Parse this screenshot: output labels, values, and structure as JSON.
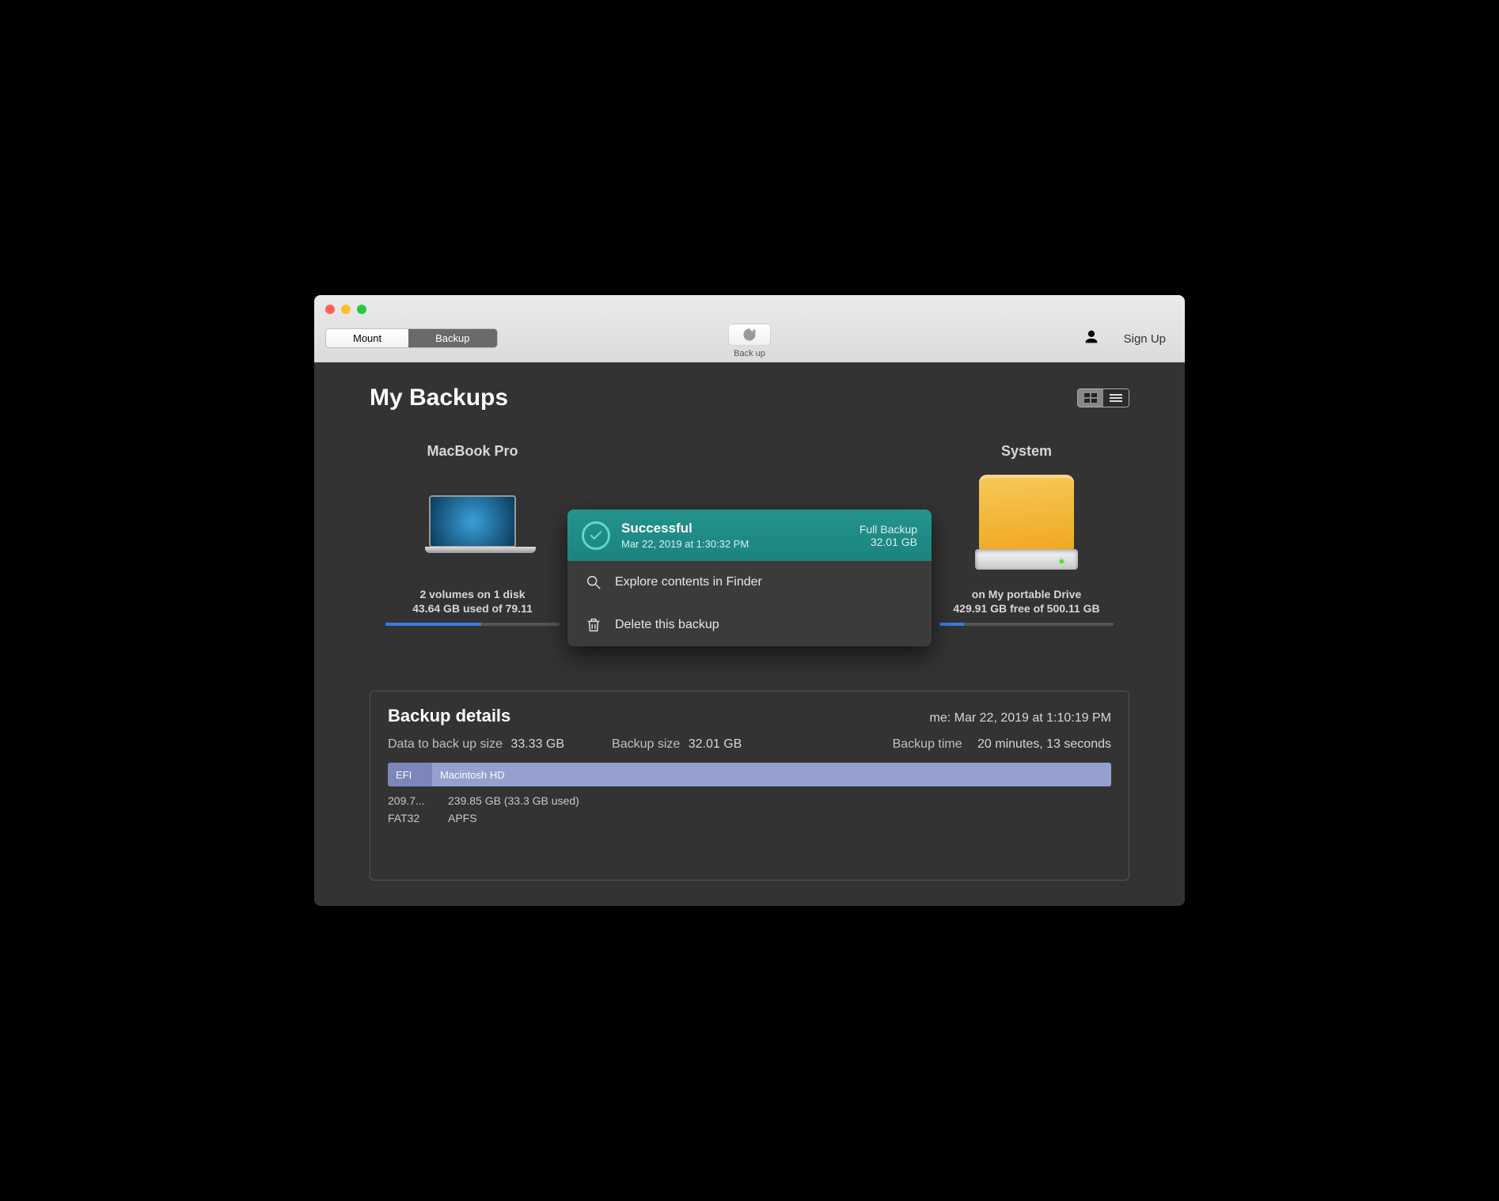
{
  "tabs": {
    "mount": "Mount",
    "backup": "Backup"
  },
  "header": {
    "backup_action": "Back up",
    "signup": "Sign Up"
  },
  "page_title": "My Backups",
  "source": {
    "name": "MacBook Pro",
    "line1": "2 volumes on 1 disk",
    "line2": "43.64 GB used of 79.11",
    "used_pct": 55
  },
  "target": {
    "name": "System",
    "line1": "on My portable Drive",
    "line2": "429.91 GB free of 500.11 GB",
    "used_pct": 14
  },
  "popup": {
    "status": "Successful",
    "timestamp": "Mar 22, 2019 at 1:30:32 PM",
    "type": "Full Backup",
    "size": "32.01 GB",
    "explore": "Explore contents in Finder",
    "delete": "Delete this backup"
  },
  "details": {
    "title": "Backup details",
    "creation_label": "me:",
    "creation_value": "Mar 22, 2019 at 1:10:19 PM",
    "data_size_label": "Data to back up size",
    "data_size_value": "33.33 GB",
    "backup_size_label": "Backup size",
    "backup_size_value": "32.01 GB",
    "time_label": "Backup time",
    "time_value": "20 minutes, 13 seconds",
    "volumes": [
      {
        "name": "EFI",
        "size": "209.7...",
        "fs": "FAT32"
      },
      {
        "name": "Macintosh HD",
        "size": "239.85 GB (33.3 GB used)",
        "fs": "APFS"
      }
    ]
  }
}
